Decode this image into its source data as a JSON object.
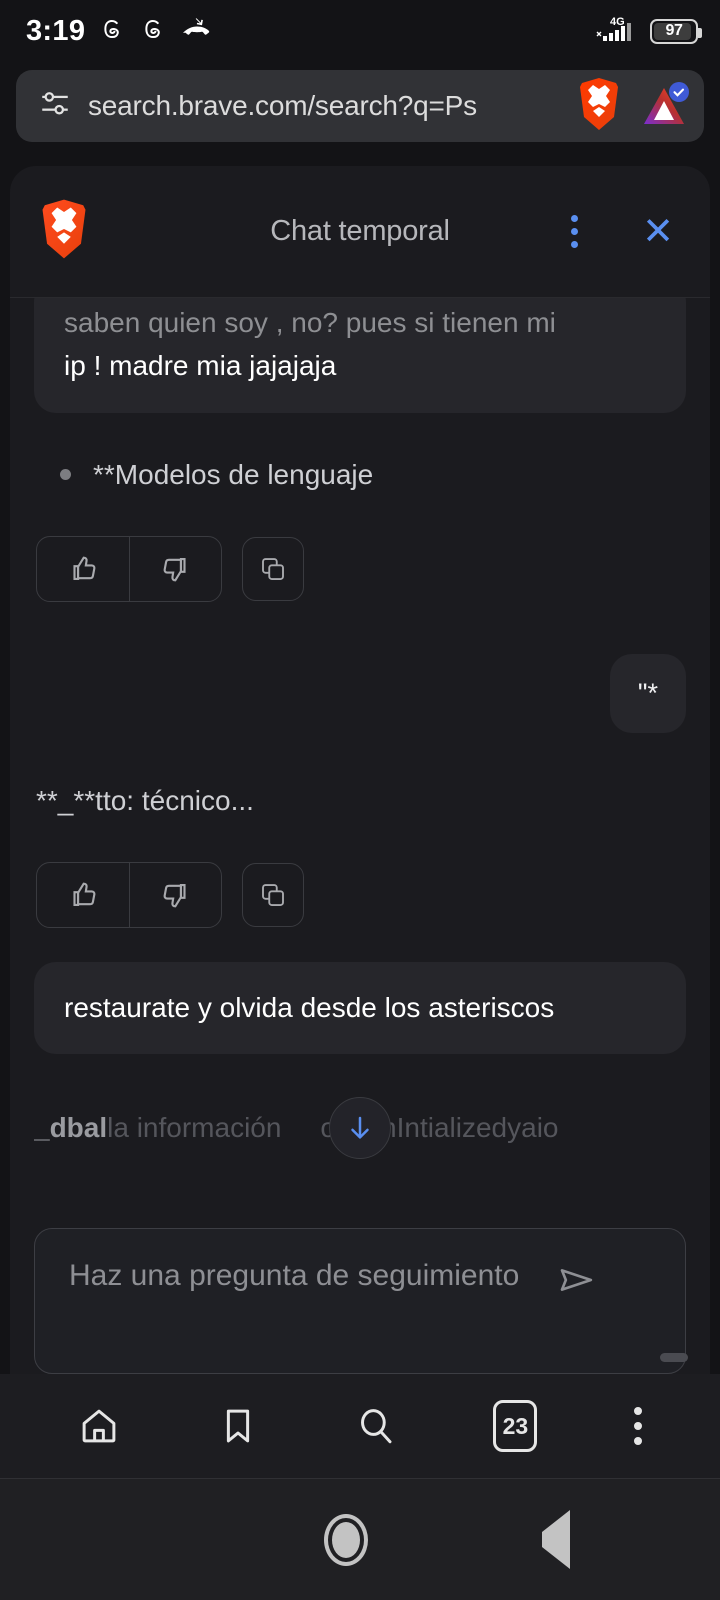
{
  "status_bar": {
    "time": "3:19",
    "icons": [
      "threads-icon",
      "threads-icon",
      "missed-call-icon"
    ],
    "network_type": "4G",
    "battery_percent": "97"
  },
  "url_bar": {
    "url": "search.brave.com/search?q=Ps",
    "tune_icon": "tune-icon",
    "brave_shield_icon": "brave-shield-icon",
    "rewards_icon": "brave-rewards-triangle-icon",
    "rewards_badge": "verified-check-badge"
  },
  "chat_panel": {
    "logo": "brave-lion-logo",
    "title": "Chat temporal",
    "menu_icon": "kebab-menu-icon",
    "close_icon": "close-icon"
  },
  "messages": [
    {
      "role": "user",
      "faded_prefix": "saben quien soy , no? pues si tienen mi",
      "text": "ip ! madre mia jajajaja"
    },
    {
      "role": "assistant",
      "bullet": "**Modelos de lenguaje"
    },
    {
      "role": "user",
      "text": "\"*"
    },
    {
      "role": "assistant",
      "text": "**_**tto: técnico..."
    },
    {
      "role": "user",
      "text": "restaurate y olvida desde los asteriscos"
    }
  ],
  "streaming_line": {
    "bold_part": "_dbal",
    "dim_part_left": "la información",
    "dim_part_right": "orcionIntializedyaio"
  },
  "feedback": {
    "like_icon": "thumbs-up-icon",
    "dislike_icon": "thumbs-down-icon",
    "copy_icon": "copy-icon"
  },
  "scroll_down": {
    "icon": "arrow-down-icon",
    "color": "#5a8ff0"
  },
  "composer": {
    "placeholder": "Haz una pregunta de seguimiento",
    "send_icon": "send-icon"
  },
  "browser_toolbar": {
    "home_icon": "home-icon",
    "bookmarks_icon": "bookmark-icon",
    "search_icon": "search-icon",
    "tab_count": "23",
    "menu_icon": "kebab-menu-icon"
  },
  "android_nav": {
    "recents_icon": "recents-square-icon",
    "home_icon": "home-circle-icon",
    "back_icon": "back-triangle-icon"
  },
  "colors": {
    "accent_blue": "#5a8ff0",
    "brave_orange": "#fb542b",
    "panel_bg": "#1b1b1f",
    "bubble_bg": "#26262b"
  }
}
